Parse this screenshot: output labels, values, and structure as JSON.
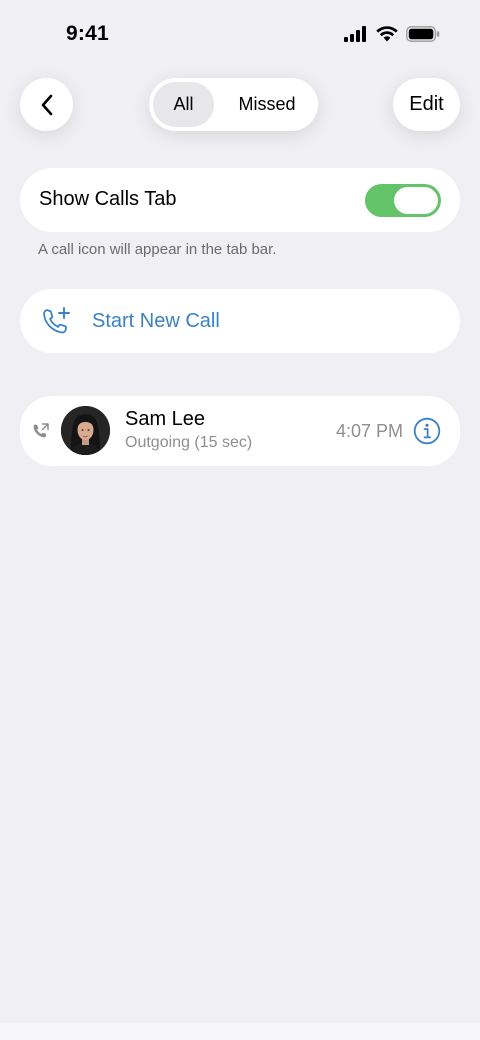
{
  "status_bar": {
    "time": "9:41",
    "icons": [
      "signal-icon",
      "wifi-icon",
      "battery-icon"
    ]
  },
  "header": {
    "back_icon": "chevron-left-icon",
    "tabs": [
      {
        "label": "All",
        "selected": true
      },
      {
        "label": "Missed",
        "selected": false
      }
    ],
    "edit_label": "Edit"
  },
  "settings": {
    "show_calls_tab_label": "Show Calls Tab",
    "show_calls_tab_on": true,
    "footnote": "A call icon will appear in the tab bar."
  },
  "new_call": {
    "icon": "phone-plus-icon",
    "label": "Start New Call"
  },
  "calls": [
    {
      "direction_icon": "outgoing-call-icon",
      "name": "Sam Lee",
      "detail": "Outgoing (15 sec)",
      "time": "4:07 PM",
      "info_icon": "info-icon"
    }
  ],
  "colors": {
    "background": "#efeff4",
    "accent": "#3a82c8",
    "toggle_on": "#63c368"
  }
}
